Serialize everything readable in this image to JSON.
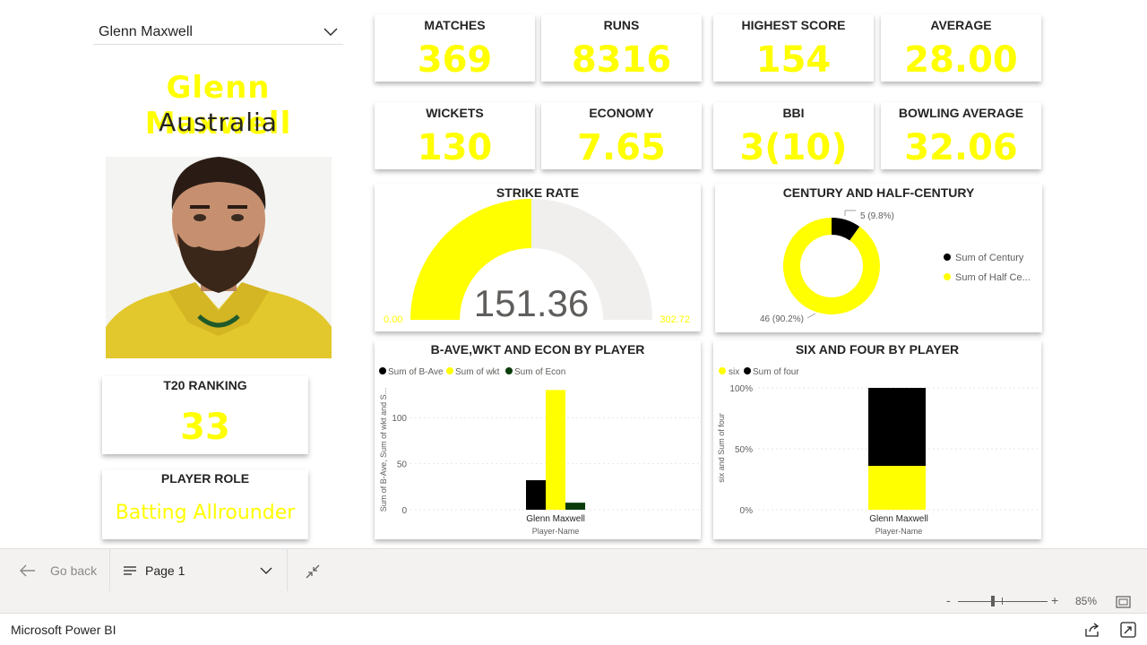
{
  "slicer": {
    "value": "Glenn Maxwell",
    "icon": "chevron-down-icon"
  },
  "player": {
    "name": "Glenn Maxwell",
    "country": "Australia",
    "photo": "player-photo"
  },
  "kpis": {
    "matches": {
      "title": "MATCHES",
      "value": "369"
    },
    "runs": {
      "title": "RUNS",
      "value": "8316"
    },
    "highest": {
      "title": "HIGHEST SCORE",
      "value": "154"
    },
    "average": {
      "title": "AVERAGE",
      "value": "28.00"
    },
    "wickets": {
      "title": "WICKETS",
      "value": "130"
    },
    "economy": {
      "title": "ECONOMY",
      "value": "7.65"
    },
    "bbi": {
      "title": "BBI",
      "value": "3(10)"
    },
    "bowling_average": {
      "title": "BOWLING AVERAGE",
      "value": "32.06"
    },
    "t20_ranking": {
      "title": "T20 RANKING",
      "value": "33"
    },
    "player_role": {
      "title": "PLAYER ROLE",
      "value": "Batting Allrounder"
    }
  },
  "gauge": {
    "title": "STRIKE RATE",
    "value": 151.36,
    "value_label": "151.36",
    "min": 0,
    "max": 302.72,
    "min_label": "0.00",
    "max_label": "302.72",
    "fill_color": "#ffff00",
    "track_color": "#f0efee"
  },
  "colors": {
    "accent": "#ffff00",
    "black": "#000000",
    "dark_green": "#0b3d0b",
    "text": "#252423",
    "muted": "#605e5c"
  },
  "chart_data": [
    {
      "type": "pie",
      "variant": "donut",
      "title": "CENTURY AND HALF-CENTURY",
      "categories": [
        "Sum of Century",
        "Sum of Half Ce..."
      ],
      "values": [
        5,
        46
      ],
      "data_labels": [
        "5 (9.8%)",
        "46 (90.2%)"
      ],
      "colors": [
        "#000000",
        "#ffff00"
      ],
      "legend": "right"
    },
    {
      "type": "bar",
      "title": "B-AVE,WKT AND ECON BY PLAYER",
      "categories": [
        "Glenn Maxwell"
      ],
      "series": [
        {
          "name": "Sum of B-Ave",
          "values": [
            32.06
          ],
          "color": "#000000"
        },
        {
          "name": "Sum of wkt",
          "values": [
            130
          ],
          "color": "#ffff00"
        },
        {
          "name": "Sum of Econ",
          "values": [
            7.65
          ],
          "color": "#0b3d0b"
        }
      ],
      "xlabel": "Player-Name",
      "ylabel": "Sum of B-Ave, Sum of wkt and S...",
      "ylim": [
        0,
        145
      ],
      "yticks": [
        0,
        50,
        100
      ],
      "ytick_labels": [
        "0",
        "50",
        "100"
      ],
      "grid": true,
      "legend": "top-left"
    },
    {
      "type": "bar",
      "variant": "stacked-100",
      "title": "SIX AND FOUR BY PLAYER",
      "categories": [
        "Glenn Maxwell"
      ],
      "series": [
        {
          "name": "six",
          "values": [
            36
          ],
          "color": "#ffff00"
        },
        {
          "name": "Sum of four",
          "values": [
            64
          ],
          "color": "#000000"
        }
      ],
      "xlabel": "Player-Name",
      "ylabel": "six and Sum of four",
      "ylim": [
        0,
        100
      ],
      "yticks": [
        0,
        50,
        100
      ],
      "ytick_labels": [
        "0%",
        "50%",
        "100%"
      ],
      "grid": true,
      "legend": "top-left"
    }
  ],
  "nav": {
    "back_label": "Go back",
    "page_label": "Page 1"
  },
  "zoom": {
    "minus": "-",
    "plus": "+",
    "percent": "85%",
    "level": 0.39
  },
  "footer": {
    "brand": "Microsoft Power BI"
  }
}
